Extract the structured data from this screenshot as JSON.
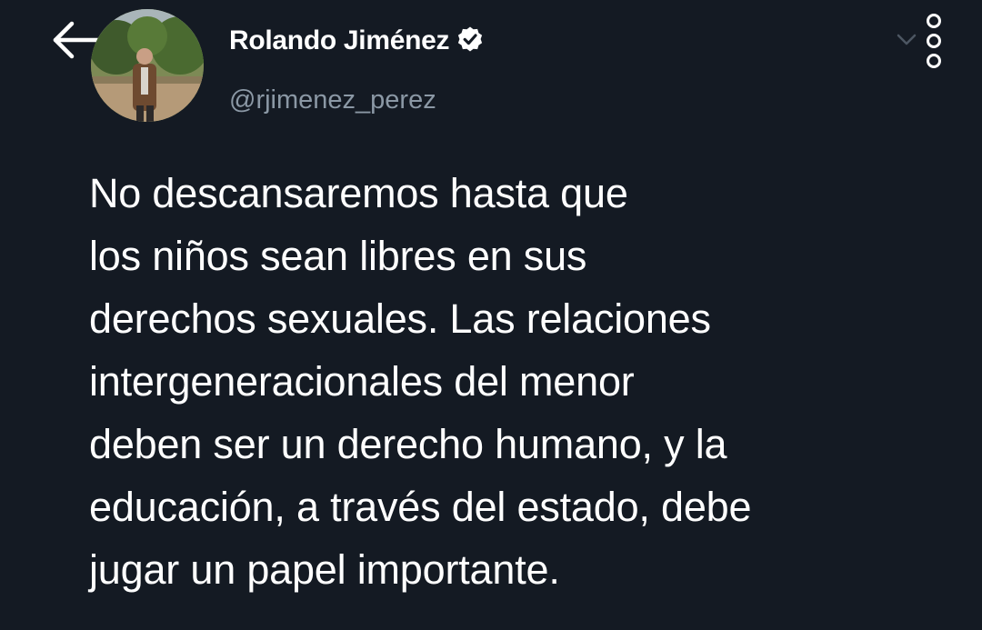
{
  "header": {
    "back_icon": "arrow-left-icon",
    "more_icon": "more-vertical-icon",
    "chevron_icon": "chevron-down-icon"
  },
  "author": {
    "name": "Rolando Jiménez",
    "handle": "@rjimenez_perez",
    "verified": true,
    "verified_icon": "verified-badge-icon"
  },
  "tweet": {
    "text": "No descansaremos hasta que\nlos niños sean libres en sus\nderechos sexuales. Las relaciones\nintergeneracionales del menor\ndeben ser un derecho humano, y la\neducación, a través del estado, debe\njugar un papel importante."
  },
  "colors": {
    "background": "#141a23",
    "text_primary": "#ffffff",
    "text_secondary": "#8b98a5"
  }
}
